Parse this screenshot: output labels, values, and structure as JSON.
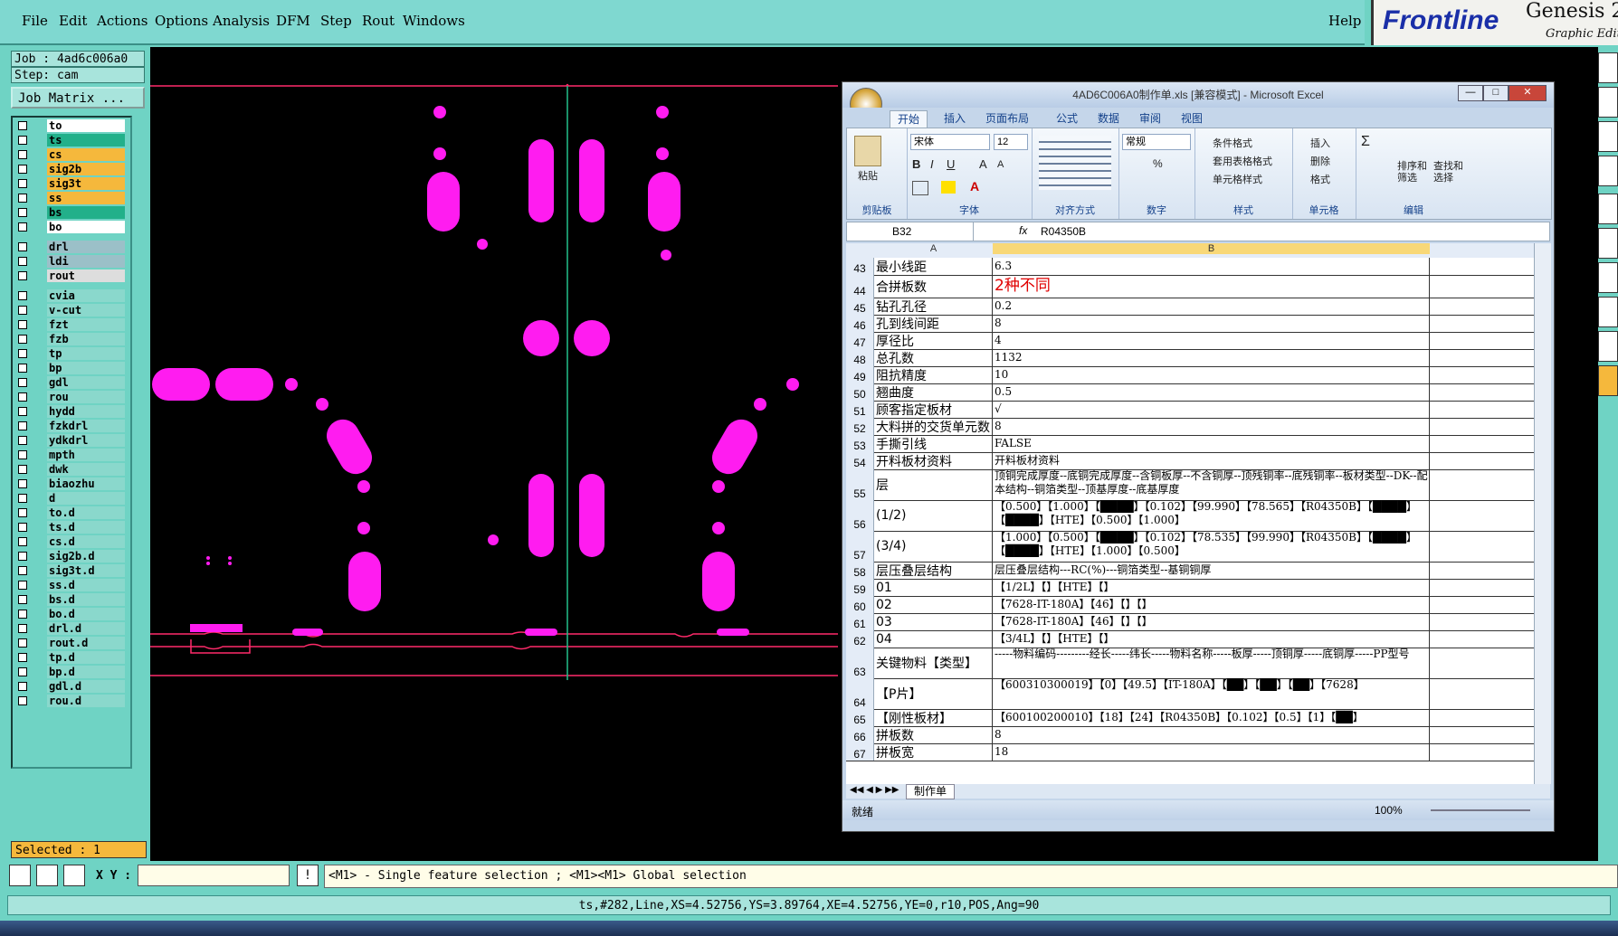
{
  "menubar": {
    "items": [
      "File",
      "Edit",
      "Actions",
      "Options",
      "Analysis",
      "DFM",
      "Step",
      "Rout",
      "Windows"
    ],
    "help": "Help",
    "brand_logo": "Frontline",
    "brand_title": "Genesis 2",
    "brand_subtitle": "Graphic Edito"
  },
  "job": {
    "job_label": "Job : 4ad6c006a0",
    "step_label": "Step: cam",
    "matrix_button": "Job Matrix ..."
  },
  "layers": [
    {
      "name": "to",
      "color": "#ffffff"
    },
    {
      "name": "ts",
      "color": "#22b08a"
    },
    {
      "name": "cs",
      "color": "#f5b83c"
    },
    {
      "name": "sig2b",
      "color": "#f5b83c"
    },
    {
      "name": "sig3t",
      "color": "#f5b83c"
    },
    {
      "name": "ss",
      "color": "#f5b83c"
    },
    {
      "name": "bs",
      "color": "#22b08a"
    },
    {
      "name": "bo",
      "color": "#ffffff"
    },
    {
      "name": "drl",
      "color": "#9bc0c8"
    },
    {
      "name": "ldi",
      "color": "#9bc0c8"
    },
    {
      "name": "rout",
      "color": "#dddddd"
    },
    {
      "name": "cvia",
      "color": "#8ad8cc"
    },
    {
      "name": "v-cut",
      "color": "#8ad8cc"
    },
    {
      "name": "fzt",
      "color": "#8ad8cc"
    },
    {
      "name": "fzb",
      "color": "#8ad8cc"
    },
    {
      "name": "tp",
      "color": "#8ad8cc"
    },
    {
      "name": "bp",
      "color": "#8ad8cc"
    },
    {
      "name": "gdl",
      "color": "#8ad8cc"
    },
    {
      "name": "rou",
      "color": "#8ad8cc"
    },
    {
      "name": "hydd",
      "color": "#8ad8cc"
    },
    {
      "name": "fzkdrl",
      "color": "#8ad8cc"
    },
    {
      "name": "ydkdrl",
      "color": "#8ad8cc"
    },
    {
      "name": "mpth",
      "color": "#8ad8cc"
    },
    {
      "name": "dwk",
      "color": "#8ad8cc"
    },
    {
      "name": "biaozhu",
      "color": "#8ad8cc"
    },
    {
      "name": "d",
      "color": "#8ad8cc"
    },
    {
      "name": "to.d",
      "color": "#8ad8cc"
    },
    {
      "name": "ts.d",
      "color": "#8ad8cc"
    },
    {
      "name": "cs.d",
      "color": "#8ad8cc"
    },
    {
      "name": "sig2b.d",
      "color": "#8ad8cc"
    },
    {
      "name": "sig3t.d",
      "color": "#8ad8cc"
    },
    {
      "name": "ss.d",
      "color": "#8ad8cc"
    },
    {
      "name": "bs.d",
      "color": "#8ad8cc"
    },
    {
      "name": "bo.d",
      "color": "#8ad8cc"
    },
    {
      "name": "drl.d",
      "color": "#8ad8cc"
    },
    {
      "name": "rout.d",
      "color": "#8ad8cc"
    },
    {
      "name": "tp.d",
      "color": "#8ad8cc"
    },
    {
      "name": "bp.d",
      "color": "#8ad8cc"
    },
    {
      "name": "gdl.d",
      "color": "#8ad8cc"
    },
    {
      "name": "rou.d",
      "color": "#8ad8cc"
    }
  ],
  "selected": "Selected : 1",
  "cmdbar": {
    "xy_label": "X Y :",
    "xy_value": "",
    "info_icon": "!",
    "hint": "<M1> - Single feature selection ; <M1><M1> Global selection"
  },
  "statusbar": "ts,#282,Line,XS=4.52756,YS=3.89764,XE=4.52756,YE=0,r10,POS,Ang=90",
  "excel": {
    "title": "4AD6C006A0制作单.xls [兼容模式] - Microsoft Excel",
    "tabs": [
      "开始",
      "插入",
      "页面布局",
      "公式",
      "数据",
      "审阅",
      "视图"
    ],
    "ribbon": {
      "paste": "粘贴",
      "clipboard": "剪贴板",
      "font_name": "宋体",
      "font_size": "12",
      "font_group": "字体",
      "align_group": "对齐方式",
      "number_format": "常规",
      "number_group": "数字",
      "cond_format": "条件格式",
      "table_format": "套用表格格式",
      "cell_style": "单元格样式",
      "style_group": "样式",
      "insert": "插入",
      "delete": "删除",
      "format": "格式",
      "cells_group": "单元格",
      "sort": "排序和\n筛选",
      "find": "查找和\n选择",
      "edit_group": "编辑"
    },
    "namebox": "B32",
    "formula": "R04350B",
    "col_a": "A",
    "col_b": "B",
    "rows": [
      {
        "n": "43",
        "a": "最小线距",
        "b": "6.3",
        "h": 1
      },
      {
        "n": "44",
        "a": "合拼板数",
        "b": "2种不同",
        "h": 1.3,
        "red": true
      },
      {
        "n": "45",
        "a": "钻孔孔径",
        "b": "0.2",
        "h": 1
      },
      {
        "n": "46",
        "a": "孔到线间距",
        "b": "8",
        "h": 1
      },
      {
        "n": "47",
        "a": "厚径比",
        "b": "4",
        "h": 1
      },
      {
        "n": "48",
        "a": "总孔数",
        "b": "1132",
        "h": 1
      },
      {
        "n": "49",
        "a": "阻抗精度",
        "b": "10",
        "h": 1
      },
      {
        "n": "50",
        "a": "翘曲度",
        "b": "0.5",
        "h": 1
      },
      {
        "n": "51",
        "a": "顾客指定板材",
        "b": "√",
        "h": 1
      },
      {
        "n": "52",
        "a": "大料拼的交货单元数",
        "b": "8",
        "h": 1
      },
      {
        "n": "53",
        "a": "手撕引线",
        "b": "FALSE",
        "h": 1
      },
      {
        "n": "54",
        "a": "开料板材资料",
        "b": "开料板材资料",
        "h": 1
      },
      {
        "n": "55",
        "a": "层",
        "b": "顶铜完成厚度--底铜完成厚度--含铜板厚--不含铜厚--顶残铜率--底残铜率--板材类型--DK--配本结构--铜箔类型--顶基厚度--底基厚度",
        "h": 2
      },
      {
        "n": "56",
        "a": "(1/2)",
        "b": "【0.500】【1.000】【████】【0.102】【99.990】【78.565】【R04350B】【████】【████】【HTE】【0.500】【1.000】",
        "h": 2
      },
      {
        "n": "57",
        "a": "(3/4)",
        "b": "【1.000】【0.500】【████】【0.102】【78.535】【99.990】【R04350B】【████】【████】【HTE】【1.000】【0.500】",
        "h": 2
      },
      {
        "n": "58",
        "a": "层压叠层结构",
        "b": "层压叠层结构---RC(%)---铜箔类型--基铜铜厚",
        "h": 1
      },
      {
        "n": "59",
        "a": "01",
        "b": "【1/2L】【】【HTE】【】",
        "h": 1
      },
      {
        "n": "60",
        "a": "02",
        "b": "【7628-IT-180A】【46】【】【】",
        "h": 1
      },
      {
        "n": "61",
        "a": "03",
        "b": "【7628-IT-180A】【46】【】【】",
        "h": 1
      },
      {
        "n": "62",
        "a": "04",
        "b": "【3/4L】【】【HTE】【】",
        "h": 1
      },
      {
        "n": "63",
        "a": "关键物料【类型】",
        "b": "-----物料编码---------经长-----纬长-----物料名称-----板厚-----顶铜厚-----底铜厚-----PP型号",
        "h": 2
      },
      {
        "n": "64",
        "a": "【P片】",
        "b": "【600310300019】【0】【49.5】【IT-180A】【██】【██】【██】【7628】",
        "h": 2
      },
      {
        "n": "65",
        "a": "【刚性板材】",
        "b": "【600100200010】【18】【24】【R04350B】【0.102】【0.5】【1】【██】",
        "h": 1
      },
      {
        "n": "66",
        "a": "拼板数",
        "b": "8",
        "h": 1
      },
      {
        "n": "67",
        "a": "拼板宽",
        "b": "18",
        "h": 1
      }
    ],
    "sheet_tab": "制作单",
    "status_ready": "就绪",
    "zoom": "100%"
  }
}
